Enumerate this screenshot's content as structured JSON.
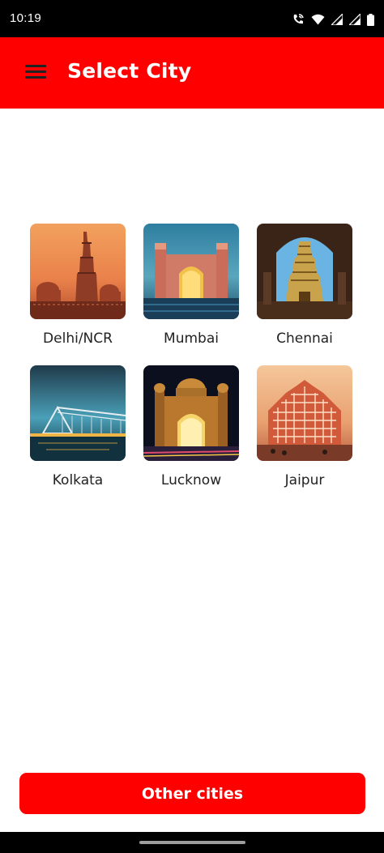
{
  "status_bar": {
    "time": "10:19",
    "icons": [
      "wifi-calling-icon",
      "wifi-icon",
      "signal-icon",
      "signal-icon",
      "battery-icon"
    ]
  },
  "app_bar": {
    "menu_icon": "hamburger-menu-icon",
    "title": "Select City",
    "background": "#fe0000"
  },
  "cities": [
    {
      "label": "Delhi/NCR",
      "image": "qutub-minar-image"
    },
    {
      "label": "Mumbai",
      "image": "gateway-of-india-image"
    },
    {
      "label": "Chennai",
      "image": "temple-gopuram-image"
    },
    {
      "label": "Kolkata",
      "image": "howrah-bridge-image"
    },
    {
      "label": "Lucknow",
      "image": "lucknow-monument-image"
    },
    {
      "label": "Jaipur",
      "image": "hawa-mahal-image"
    }
  ],
  "other_button": {
    "label": "Other cities",
    "background": "#fe0000"
  }
}
